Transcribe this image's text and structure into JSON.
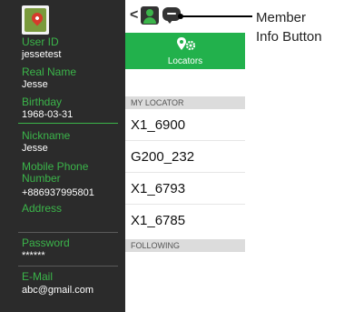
{
  "profile": {
    "fields": [
      {
        "label": "User ID",
        "value": "jessetest"
      },
      {
        "label": "Real Name",
        "value": "Jesse"
      },
      {
        "label": "Birthday",
        "value": "1968-03-31"
      },
      {
        "label": "Nickname",
        "value": "Jesse"
      },
      {
        "label": "Mobile Phone Number",
        "value": "+886937995801"
      },
      {
        "label": "Address",
        "value": ""
      },
      {
        "label": "Password",
        "value": "******"
      },
      {
        "label": "E-Mail",
        "value": "abc@gmail.com"
      }
    ]
  },
  "toolbar": {
    "back_glyph": "<",
    "locators_label": "Locators"
  },
  "my_locator": {
    "header": "MY LOCATOR",
    "items": [
      "X1_6900",
      "G200_232",
      "X1_6793",
      "X1_6785"
    ]
  },
  "following": {
    "header": "FOLLOWING"
  },
  "annotation": {
    "line1": "Member",
    "line2": "Info Button"
  },
  "colors": {
    "accent_green": "#22b14c",
    "label_green": "#3bb54a",
    "panel_dark": "#2b2b2b"
  }
}
